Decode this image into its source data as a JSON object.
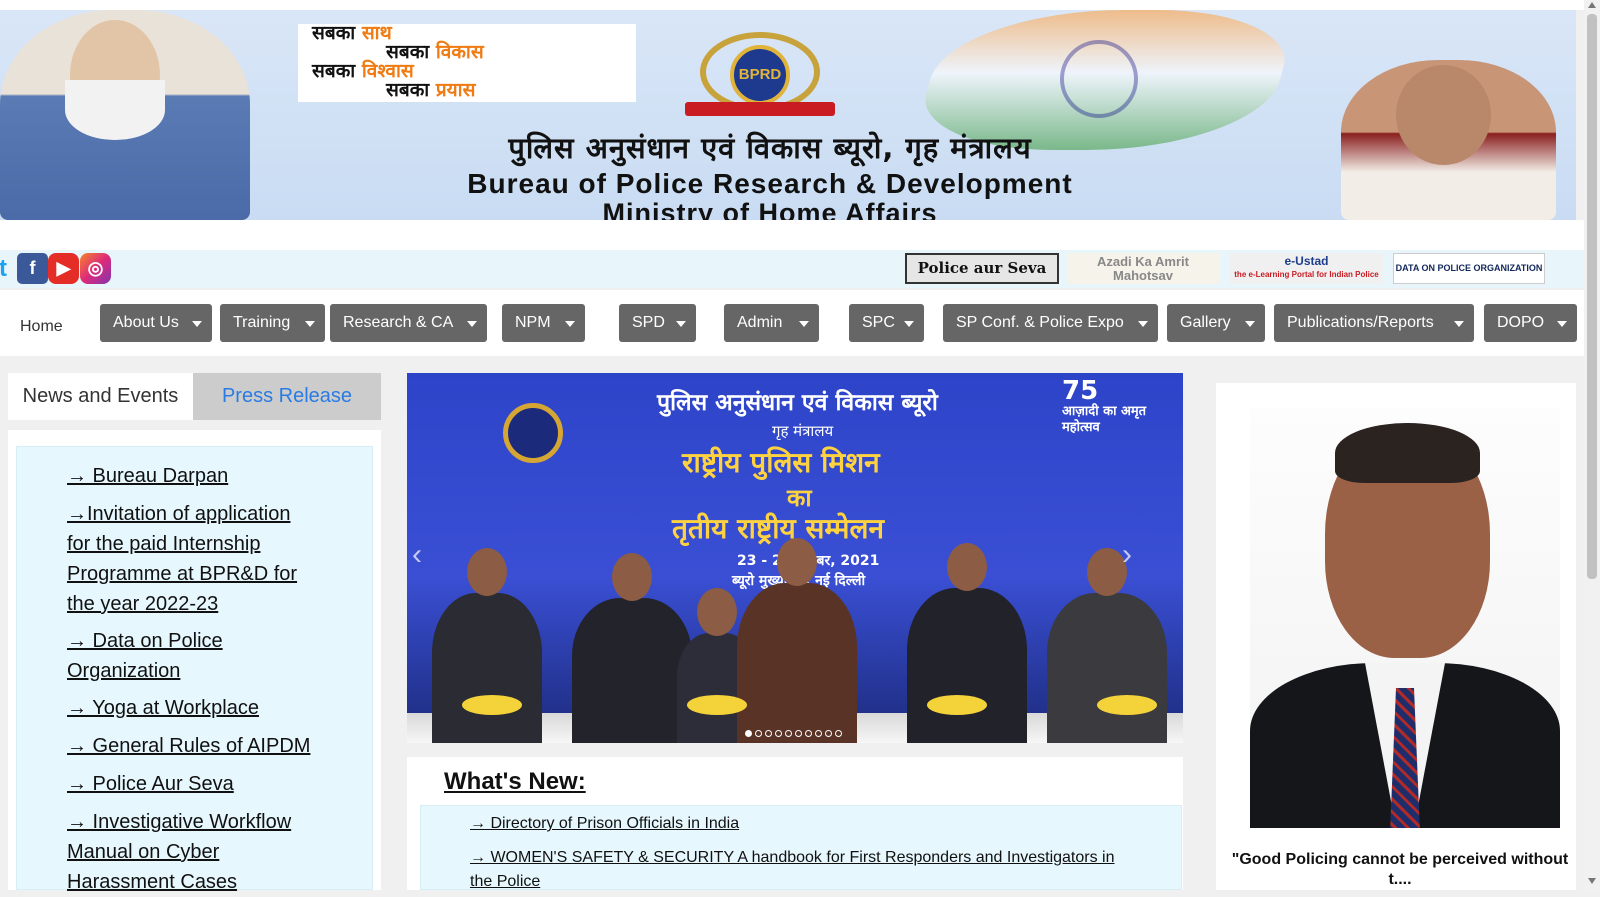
{
  "banner": {
    "slogan_lines": [
      {
        "black": "सबका ",
        "orange": "साथ"
      },
      {
        "black": "सबका ",
        "orange": "विकास"
      },
      {
        "black": "सबका ",
        "orange": "विश्वास"
      },
      {
        "black": "सबका ",
        "orange": "प्रयास"
      }
    ],
    "emblem_text": "BPRD",
    "title_hindi": "पुलिस अनुसंधान एवं विकास ब्यूरो, गृह मंत्रालय",
    "title_english_1": "Bureau of Police Research & Development",
    "title_english_2": "Ministry of Home Affairs"
  },
  "social": {
    "twitter": "t",
    "facebook": "f",
    "youtube": "▶",
    "instagram": "◎"
  },
  "partners": {
    "police_aur_seva": "Police aur Seva",
    "azadi": "Azadi Ka Amrit Mahotsav",
    "eustad_title": "e-Ustad",
    "eustad_sub": "the e-Learning Portal for Indian Police",
    "dopo": "DATA ON POLICE ORGANIZATION"
  },
  "nav": {
    "home": "Home",
    "items": [
      "About Us",
      "Training",
      "Research & CA",
      "NPM",
      "SPD",
      "Admin",
      "SPC",
      "SP Conf. & Police Expo",
      "Gallery",
      "Publications/Reports",
      "DOPO"
    ]
  },
  "left_tabs": {
    "news": "News and Events",
    "press": "Press Release"
  },
  "news_items": [
    "→ Bureau Darpan",
    "→Invitation of application for the paid Internship Programme at BPR&D for the year 2022-23",
    "→ Data on Police Organization",
    "→ Yoga at Workplace",
    "→ General Rules of AIPDM",
    "→ Police Aur Seva",
    "→ Investigative Workflow Manual on Cyber Harassment Cases"
  ],
  "slider": {
    "hi1": "पुलिस अनुसंधान एवं विकास ब्यूरो",
    "hi2": "गृह मंत्रालय",
    "hi3": "राष्ट्रीय पुलिस मिशन",
    "hi4": "का",
    "hi5": "तृतीय राष्ट्रीय सम्मेलन",
    "date": "23 - 24 नवम्बर, 2021",
    "place": "ब्यूरो मुख्यालय, नई दिल्ली",
    "azadi_75": "75",
    "azadi_text": "आज़ादी का अमृत महोत्सव",
    "prev": "‹",
    "next": "›",
    "dots_total": 10,
    "active_dot": 1
  },
  "whats_new": {
    "title": "What's New:",
    "items": [
      "→ Directory of Prison Officials in India",
      "→ WOMEN'S SAFETY & SECURITY A handbook for First Responders and Investigators in the Police"
    ]
  },
  "dg": {
    "quote": "\"Good Policing cannot be perceived without t...."
  }
}
